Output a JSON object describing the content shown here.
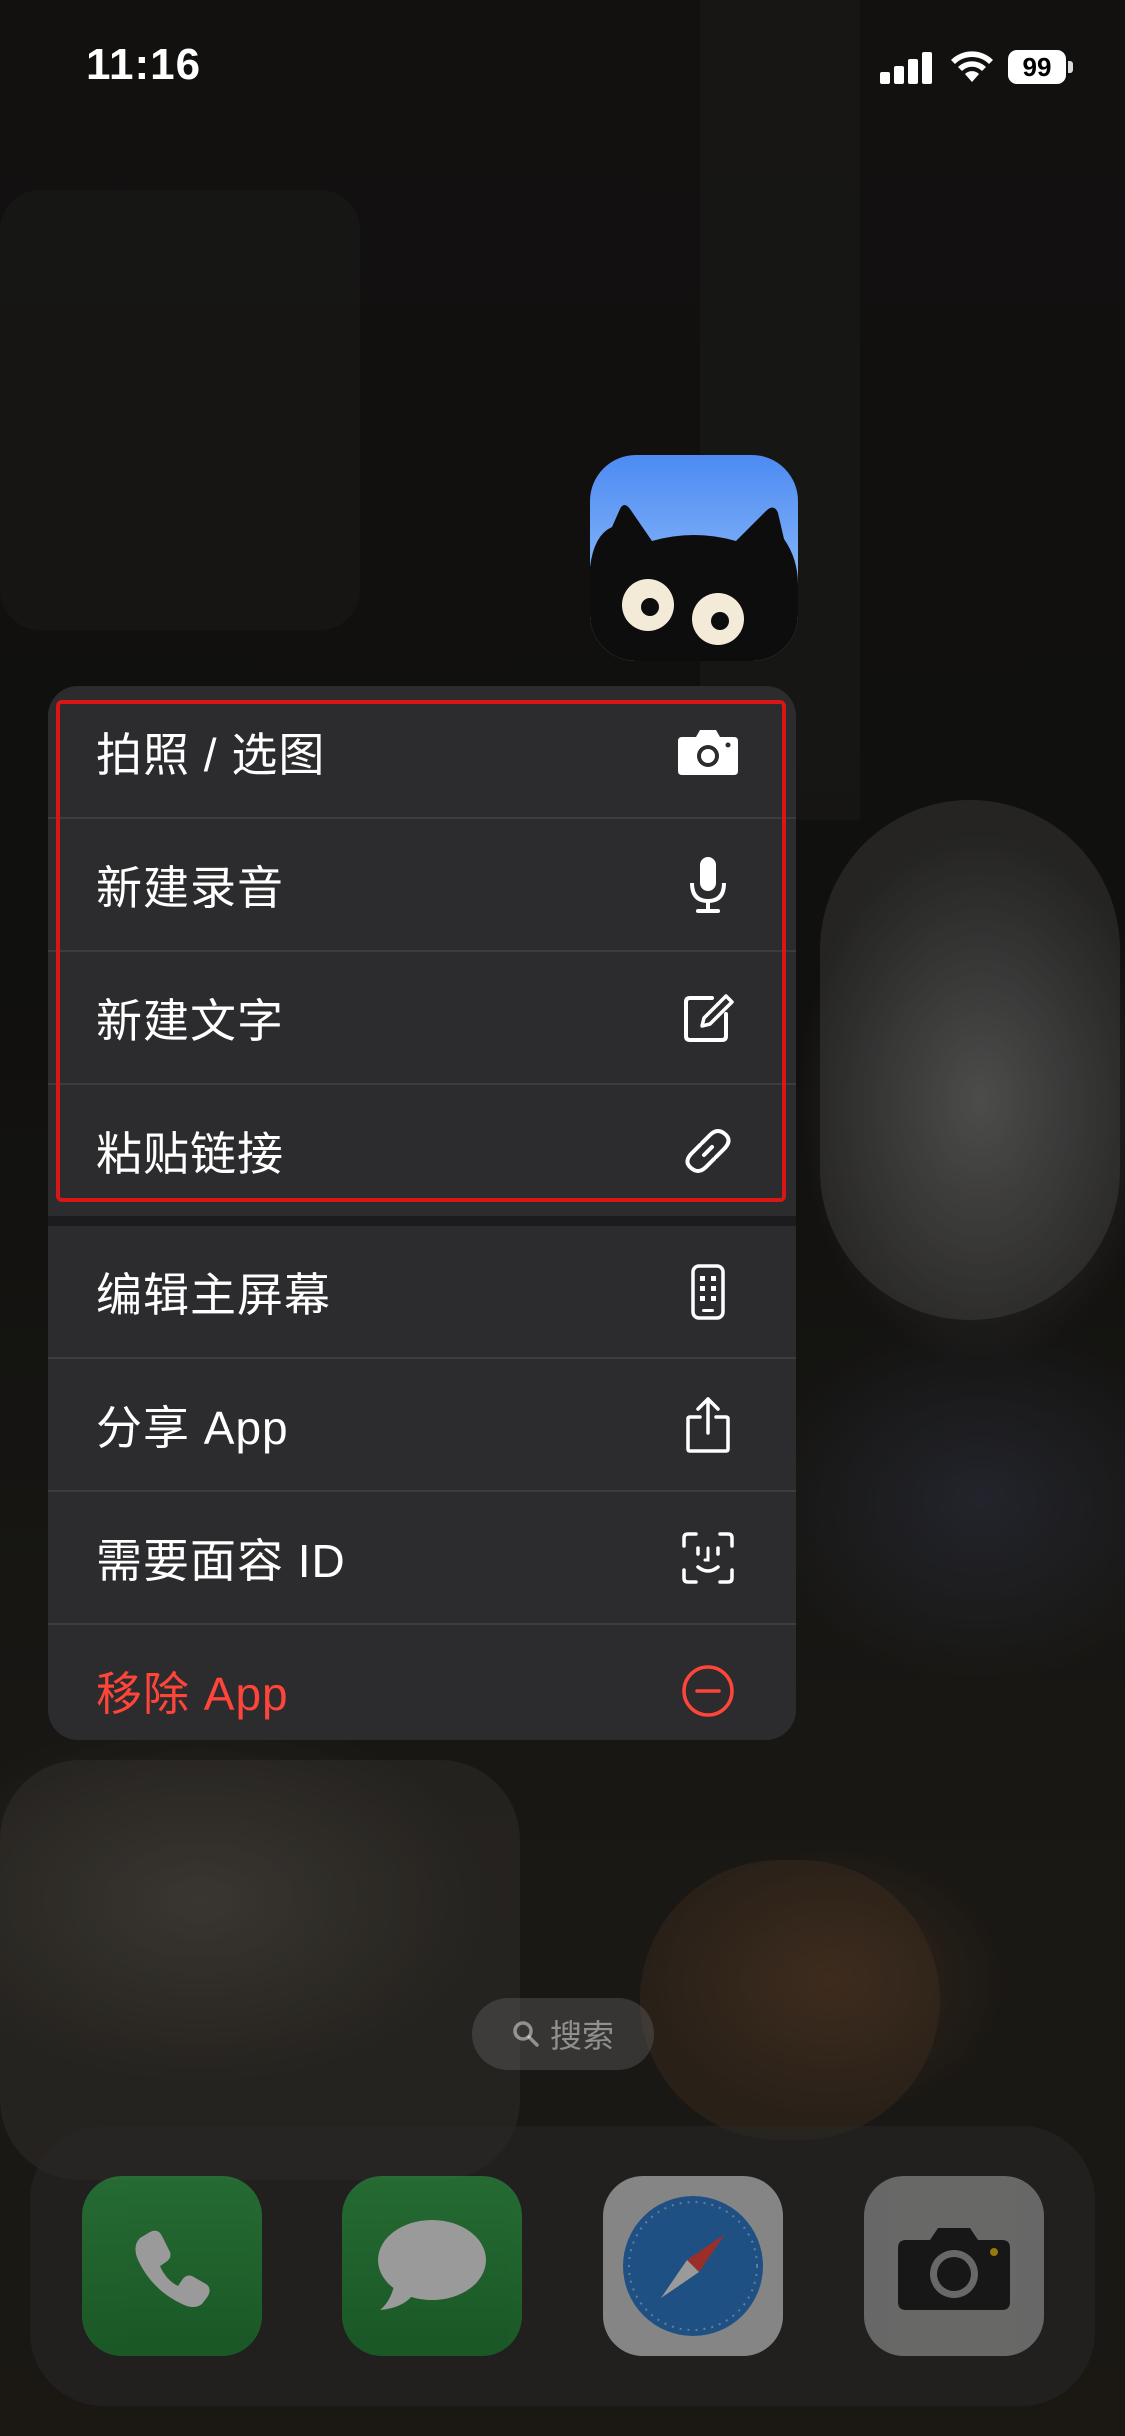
{
  "status_bar": {
    "time": "11:16",
    "battery_level": "99"
  },
  "app_icon": {
    "name": "cat-face-icon",
    "background_gradient": [
      "#4d8bf2",
      "#a7c9fb"
    ]
  },
  "context_menu": {
    "items": [
      {
        "label": "拍照 / 选图",
        "icon": "camera-icon",
        "destructive": false
      },
      {
        "label": "新建录音",
        "icon": "microphone-icon",
        "destructive": false
      },
      {
        "label": "新建文字",
        "icon": "compose-icon",
        "destructive": false
      },
      {
        "label": "粘贴链接",
        "icon": "link-icon",
        "destructive": false
      },
      {
        "label": "编辑主屏幕",
        "icon": "phone-apps-icon",
        "destructive": false
      },
      {
        "label": "分享 App",
        "icon": "share-icon",
        "destructive": false
      },
      {
        "label": "需要面容 ID",
        "icon": "face-id-icon",
        "destructive": false
      },
      {
        "label": "移除 App",
        "icon": "minus-circle-icon",
        "destructive": true
      }
    ],
    "highlight_color": "#d81616",
    "destructive_color": "#ff453a"
  },
  "search": {
    "label": "搜索"
  },
  "dock": {
    "apps": [
      "phone-app",
      "messages-app",
      "safari-app",
      "camera-app"
    ]
  }
}
